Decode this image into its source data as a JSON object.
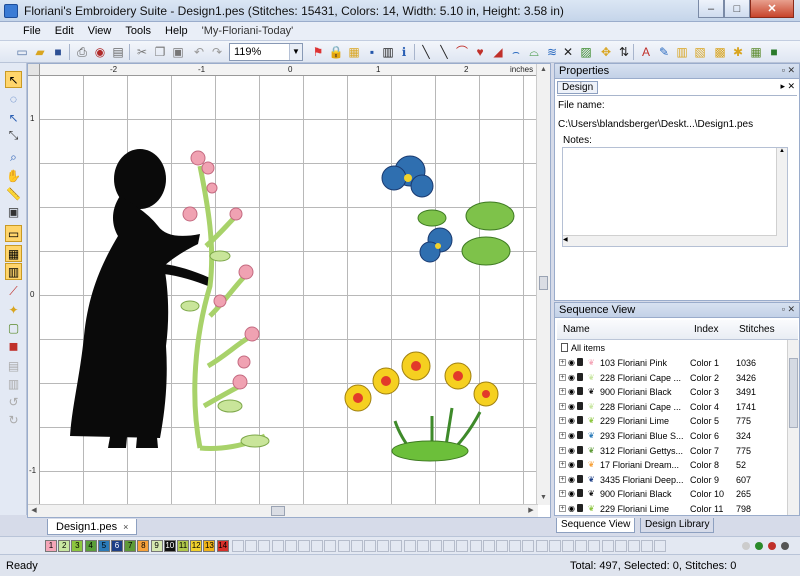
{
  "window": {
    "title": "Floriani's Embroidery Suite - Design1.pes (Stitches: 15431, Colors: 14, Width: 5.10 in, Height: 3.58 in)",
    "minimize": "–",
    "maximize": "□",
    "close": "✕"
  },
  "menu": {
    "items": [
      "File",
      "Edit",
      "View",
      "Tools",
      "Help"
    ],
    "mru": "'My-Floriani-Today'"
  },
  "toolbar": {
    "zoom": "119%"
  },
  "ruler": {
    "top_labels": [
      "-2",
      "-1",
      "0",
      "1",
      "2"
    ],
    "top_unit": "inches",
    "left_labels": [
      "1",
      "0",
      "-1"
    ],
    "left_unit": "inches"
  },
  "document": {
    "tab_label": "Design1.pes",
    "tab_close": "×"
  },
  "palette": {
    "swatches": [
      {
        "n": "1",
        "color": "#f4a6b8"
      },
      {
        "n": "2",
        "color": "#c8e6a0"
      },
      {
        "n": "3",
        "color": "#8cc63f"
      },
      {
        "n": "4",
        "color": "#5a9e3a"
      },
      {
        "n": "5",
        "color": "#2b7bb9"
      },
      {
        "n": "6",
        "color": "#1d3f86"
      },
      {
        "n": "7",
        "color": "#5e9a38"
      },
      {
        "n": "8",
        "color": "#f7a13a"
      },
      {
        "n": "9",
        "color": "#d6e8b0"
      },
      {
        "n": "10",
        "color": "#111111"
      },
      {
        "n": "11",
        "color": "#b0c84a"
      },
      {
        "n": "12",
        "color": "#f2d22c"
      },
      {
        "n": "13",
        "color": "#f0b318"
      },
      {
        "n": "14",
        "color": "#d8302a"
      }
    ]
  },
  "status": {
    "ready": "Ready",
    "stats": "Total: 497, Selected: 0, Stitches: 0"
  },
  "properties": {
    "header": "Properties",
    "tab": "Design",
    "file_name_label": "File name:",
    "file_path": "C:\\Users\\blandsberger\\Deskt...\\Design1.pes",
    "notes_label": "Notes:"
  },
  "sequence": {
    "header": "Sequence View",
    "columns": {
      "name": "Name",
      "index": "Index",
      "stitches": "Stitches"
    },
    "all_items": "All items",
    "rows": [
      {
        "name": "103 Floriani Pink",
        "index": "Color 1",
        "stitches": "1036",
        "thumb_color": "#f4a6b8"
      },
      {
        "name": "228 Floriani Cape ...",
        "index": "Color 2",
        "stitches": "3426",
        "thumb_color": "#c8e6a0"
      },
      {
        "name": "900 Floriani Black",
        "index": "Color 3",
        "stitches": "3491",
        "thumb_color": "#111111"
      },
      {
        "name": "228 Floriani Cape ...",
        "index": "Color 4",
        "stitches": "1741",
        "thumb_color": "#c8e6a0"
      },
      {
        "name": "229 Floriani Lime",
        "index": "Color 5",
        "stitches": "775",
        "thumb_color": "#8cc63f"
      },
      {
        "name": "293 Floriani Blue S...",
        "index": "Color 6",
        "stitches": "324",
        "thumb_color": "#2b7bb9"
      },
      {
        "name": "312 Floriani Gettys...",
        "index": "Color 7",
        "stitches": "775",
        "thumb_color": "#5e9a38"
      },
      {
        "name": "17 Floriani Dream...",
        "index": "Color 8",
        "stitches": "52",
        "thumb_color": "#f7a13a"
      },
      {
        "name": "3435 Floriani Deep...",
        "index": "Color 9",
        "stitches": "607",
        "thumb_color": "#1d3f86"
      },
      {
        "name": "900 Floriani Black",
        "index": "Color 10",
        "stitches": "265",
        "thumb_color": "#111111"
      },
      {
        "name": "229 Floriani Lime",
        "index": "Color 11",
        "stitches": "798",
        "thumb_color": "#8cc63f"
      }
    ]
  },
  "bottom_tabs": {
    "sequence_view": "Sequence View",
    "design_library": "Design Library"
  }
}
